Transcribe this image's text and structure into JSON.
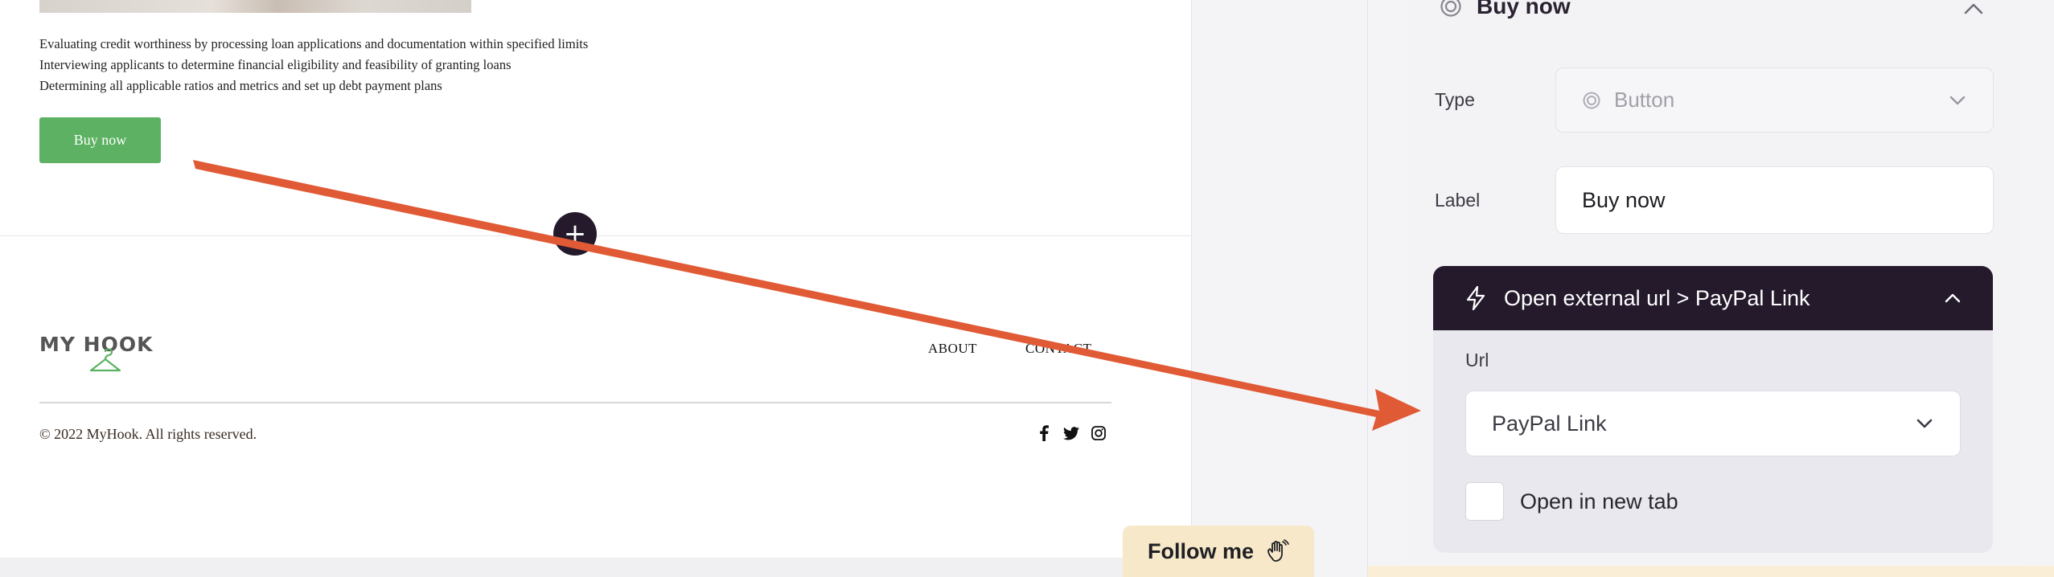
{
  "site": {
    "duties": [
      "Evaluating credit worthiness by processing loan applications and documentation within specified limits",
      "Interviewing applicants to determine financial eligibility and feasibility of granting loans",
      "Determining all applicable ratios and metrics and set up debt payment plans"
    ],
    "buy_button": "Buy now",
    "add_section": "+",
    "logo": "MY HOOK",
    "nav": {
      "about": "ABOUT",
      "contact": "CONTACT"
    },
    "copyright": "© 2022 MyHook. All rights reserved.",
    "socials": [
      "facebook-icon",
      "twitter-icon",
      "instagram-icon"
    ],
    "accent_color": "#5cb162"
  },
  "follow_badge": {
    "label": "Follow me",
    "icon": "waving-hand-icon"
  },
  "panel": {
    "header_title": "Buy now",
    "type_label": "Type",
    "type_value": "Button",
    "label_label": "Label",
    "label_value": "Buy now",
    "action": {
      "title": "Open external url > PayPal Link",
      "url_label": "Url",
      "url_value": "PayPal Link",
      "new_tab_label": "Open in new tab",
      "new_tab_checked": false
    },
    "dark_color": "#241a2c"
  },
  "annotation": {
    "arrow_color": "#e05a35"
  }
}
